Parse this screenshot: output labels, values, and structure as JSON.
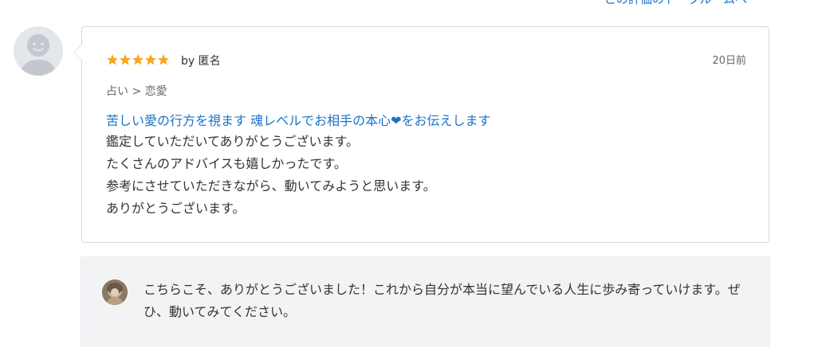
{
  "header": {
    "top_link": "この評価のトークルームへ"
  },
  "review": {
    "avatar_icon": "default-user-avatar-icon",
    "rating": 5,
    "star_color": "#f5a623",
    "byline": "by 匿名",
    "date": "20日前",
    "category": "占い > 恋愛",
    "service_title": "苦しい愛の行方を視ます 魂レベルでお相手の本心❤をお伝えします",
    "body_lines": [
      "鑑定していただいてありがとうございます。",
      "たくさんのアドバイスも嬉しかったです。",
      "参考にさせていただきながら、動いてみようと思います。",
      "ありがとうございます。"
    ]
  },
  "reply": {
    "avatar_icon": "seller-avatar-icon",
    "text": "こちらこそ、ありがとうございました！これから自分が本当に望んでいる人生に歩み寄っていけます。ぜひ、動いてみてください。"
  },
  "colors": {
    "link": "#1a73c8",
    "star": "#f5a623",
    "reply_bg": "#f2f3f5"
  }
}
